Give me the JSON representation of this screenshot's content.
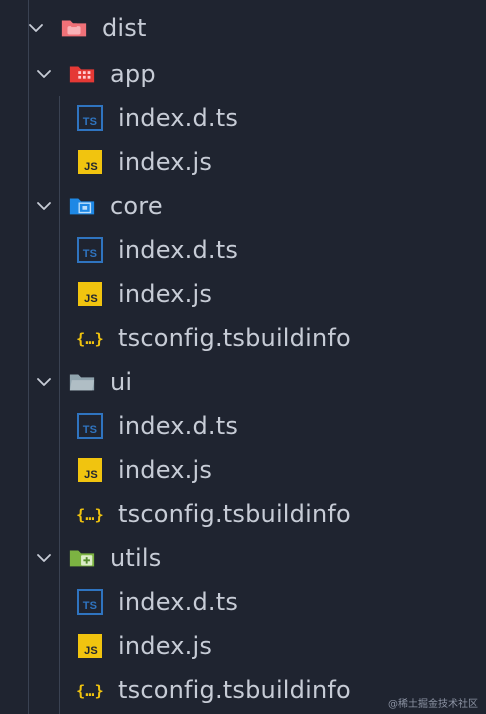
{
  "tree": {
    "root_folder": "dist",
    "folders": [
      {
        "name": "app",
        "files": [
          "index.d.ts",
          "index.js"
        ]
      },
      {
        "name": "core",
        "files": [
          "index.d.ts",
          "index.js",
          "tsconfig.tsbuildinfo"
        ]
      },
      {
        "name": "ui",
        "files": [
          "index.d.ts",
          "index.js",
          "tsconfig.tsbuildinfo"
        ]
      },
      {
        "name": "utils",
        "files": [
          "index.d.ts",
          "index.js",
          "tsconfig.tsbuildinfo"
        ]
      }
    ]
  },
  "watermark": "@稀土掘金技术社区",
  "icons": {
    "root": "dist-folder-icon",
    "app": "app-folder-icon",
    "core": "core-folder-icon",
    "ui": "ui-folder-icon",
    "utils": "utils-folder-icon",
    "ts": "typescript-file-icon",
    "js": "javascript-file-icon",
    "json": "json-file-icon"
  },
  "colors": {
    "background": "#1f2430",
    "text": "#c7ccd6",
    "ts": "#2f74c0",
    "js": "#f1c40f",
    "json": "#f1c40f",
    "dist": "#f07178",
    "app": "#e53935",
    "core": "#1e88e5",
    "ui": "#90a4ae",
    "utils": "#7cb342"
  }
}
